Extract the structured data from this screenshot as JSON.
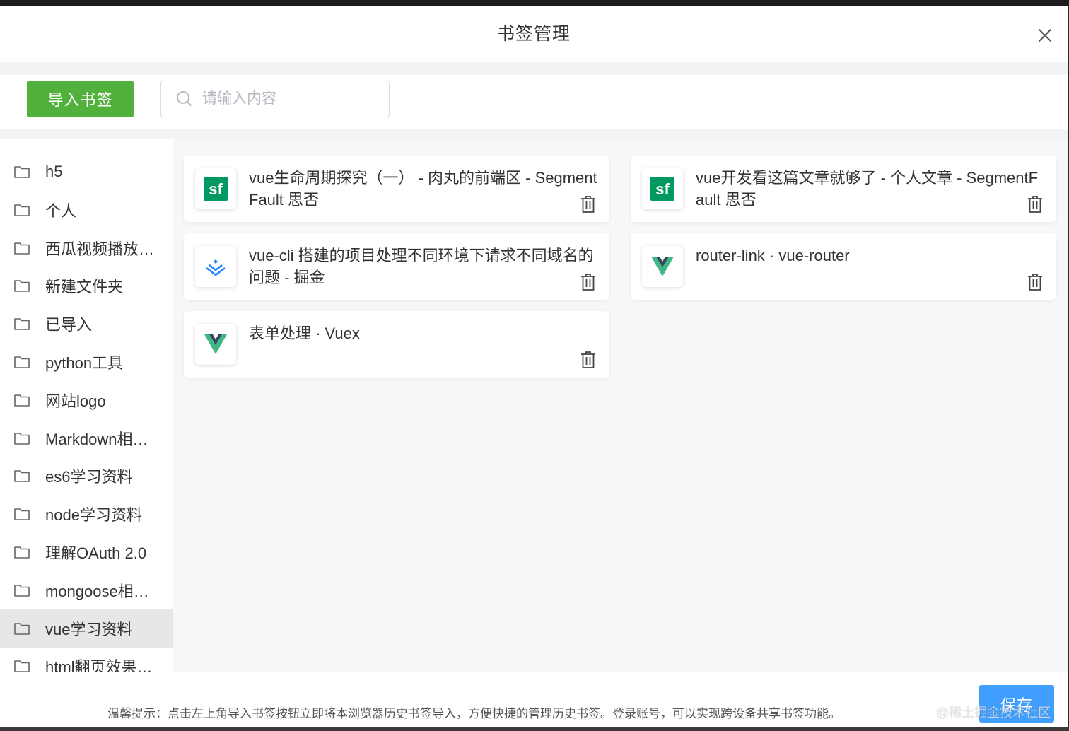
{
  "dialog": {
    "title": "书签管理",
    "close_icon": "close-icon"
  },
  "toolbar": {
    "import_label": "导入书签",
    "search_placeholder": "请输入内容",
    "search_value": ""
  },
  "sidebar": {
    "items": [
      {
        "label": "h5",
        "active": false
      },
      {
        "label": "个人",
        "active": false
      },
      {
        "label": "西瓜视频播放…",
        "active": false
      },
      {
        "label": "新建文件夹",
        "active": false
      },
      {
        "label": "已导入",
        "active": false
      },
      {
        "label": "python工具",
        "active": false
      },
      {
        "label": "网站logo",
        "active": false
      },
      {
        "label": "Markdown相…",
        "active": false
      },
      {
        "label": "es6学习资料",
        "active": false
      },
      {
        "label": "node学习资料",
        "active": false
      },
      {
        "label": "理解OAuth 2.0",
        "active": false
      },
      {
        "label": "mongoose相…",
        "active": false
      },
      {
        "label": "vue学习资料",
        "active": true
      },
      {
        "label": "html翻页效果…",
        "active": false
      }
    ]
  },
  "bookmarks": [
    {
      "title": "vue生命周期探究（一） - 肉丸的前端区 - SegmentFault 思否",
      "icon": "segmentfault-logo"
    },
    {
      "title": "vue开发看这篇文章就够了 - 个人文章 - SegmentFault 思否",
      "icon": "segmentfault-logo"
    },
    {
      "title": "vue-cli 搭建的项目处理不同环境下请求不同域名的问题 - 掘金",
      "icon": "juejin-logo"
    },
    {
      "title": "router-link · vue-router",
      "icon": "vue-logo"
    },
    {
      "title": "表单处理 · Vuex",
      "icon": "vue-logo"
    }
  ],
  "logos": {
    "segmentfault_text": "sf"
  },
  "footer": {
    "tip": "温馨提示：点击左上角导入书签按钮立即将本浏览器历史书签导入，方便快捷的管理历史书签。登录账号，可以实现跨设备共享书签功能。",
    "save_label": "保存",
    "watermark": "@稀土掘金技术社区"
  },
  "colors": {
    "import_button": "#52b13c",
    "save_button": "#409eff",
    "active_folder_bg": "#e6e7e9",
    "segmentfault_green": "#009a61",
    "vue_green": "#41b883",
    "vue_dark": "#35495e",
    "juejin_blue": "#1e80ff"
  }
}
